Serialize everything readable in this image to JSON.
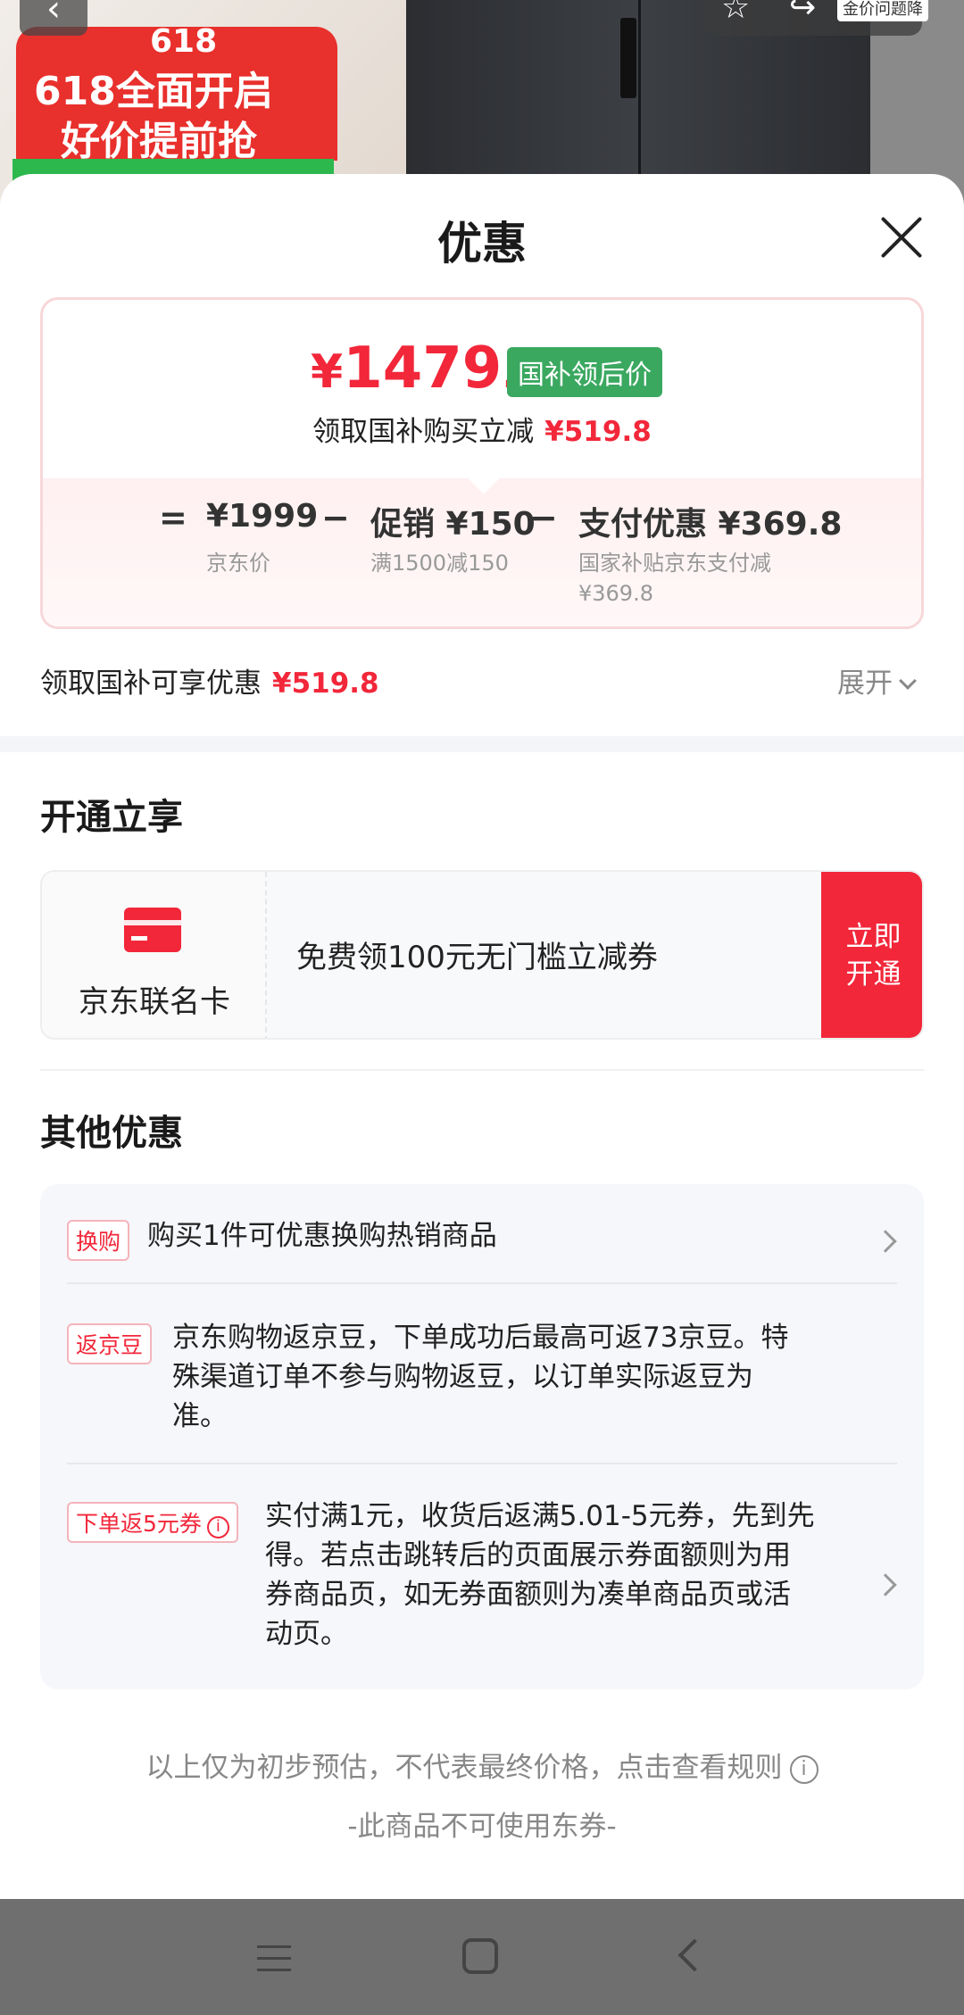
{
  "background": {
    "promo_num": "618",
    "promo_line1": "618全面开启",
    "promo_line2": "好价提前抢",
    "top_badge": "金价问题降"
  },
  "sheet": {
    "title": "优惠"
  },
  "price_card": {
    "currency": "¥",
    "price_int": "1479",
    "price_dec": ".2",
    "tag": "国补领后价",
    "subsidy_label": "领取国补购买立减",
    "subsidy_value": "¥519.8",
    "formula": {
      "eq": "=",
      "minus": "−",
      "items": [
        {
          "value": "¥1999",
          "sub": "京东价"
        },
        {
          "value": "促销 ¥150",
          "sub": "满1500减150"
        },
        {
          "value": "支付优惠 ¥369.8",
          "sub": "国家补贴京东支付减",
          "sub2": "¥369.8"
        }
      ]
    }
  },
  "discount_row": {
    "label": "领取国补可享优惠",
    "value": "¥519.8",
    "expand": "展开"
  },
  "open_section": {
    "title": "开通立享",
    "card_name": "京东联名卡",
    "card_desc": "免费领100元无门槛立减券",
    "button": "立即开通",
    "button_line1": "立即",
    "button_line2": "开通"
  },
  "other_section": {
    "title": "其他优惠",
    "items": [
      {
        "tag": "换购",
        "text": "购买1件可优惠换购热销商品"
      },
      {
        "tag": "返京豆",
        "line1": "京东购物返京豆，下单成功后最高可返73京豆。特",
        "line2": "殊渠道订单不参与购物返豆，以订单实际返豆为",
        "line3": "准。"
      },
      {
        "tag": "下单返5元券",
        "line1": "实付满1元，收货后返满5.01-5元券，先到先",
        "line2": "得。若点击跳转后的页面展示券面额则为用",
        "line3": "券商品页，如无券面额则为凑单商品页或活",
        "line4": "动页。"
      }
    ]
  },
  "footer": {
    "note": "以上仅为初步预估，不代表最终价格，点击查看规则",
    "note2": "-此商品不可使用东券-"
  },
  "colors": {
    "accent_red": "#f2273a",
    "green_tag": "#3ba860"
  }
}
